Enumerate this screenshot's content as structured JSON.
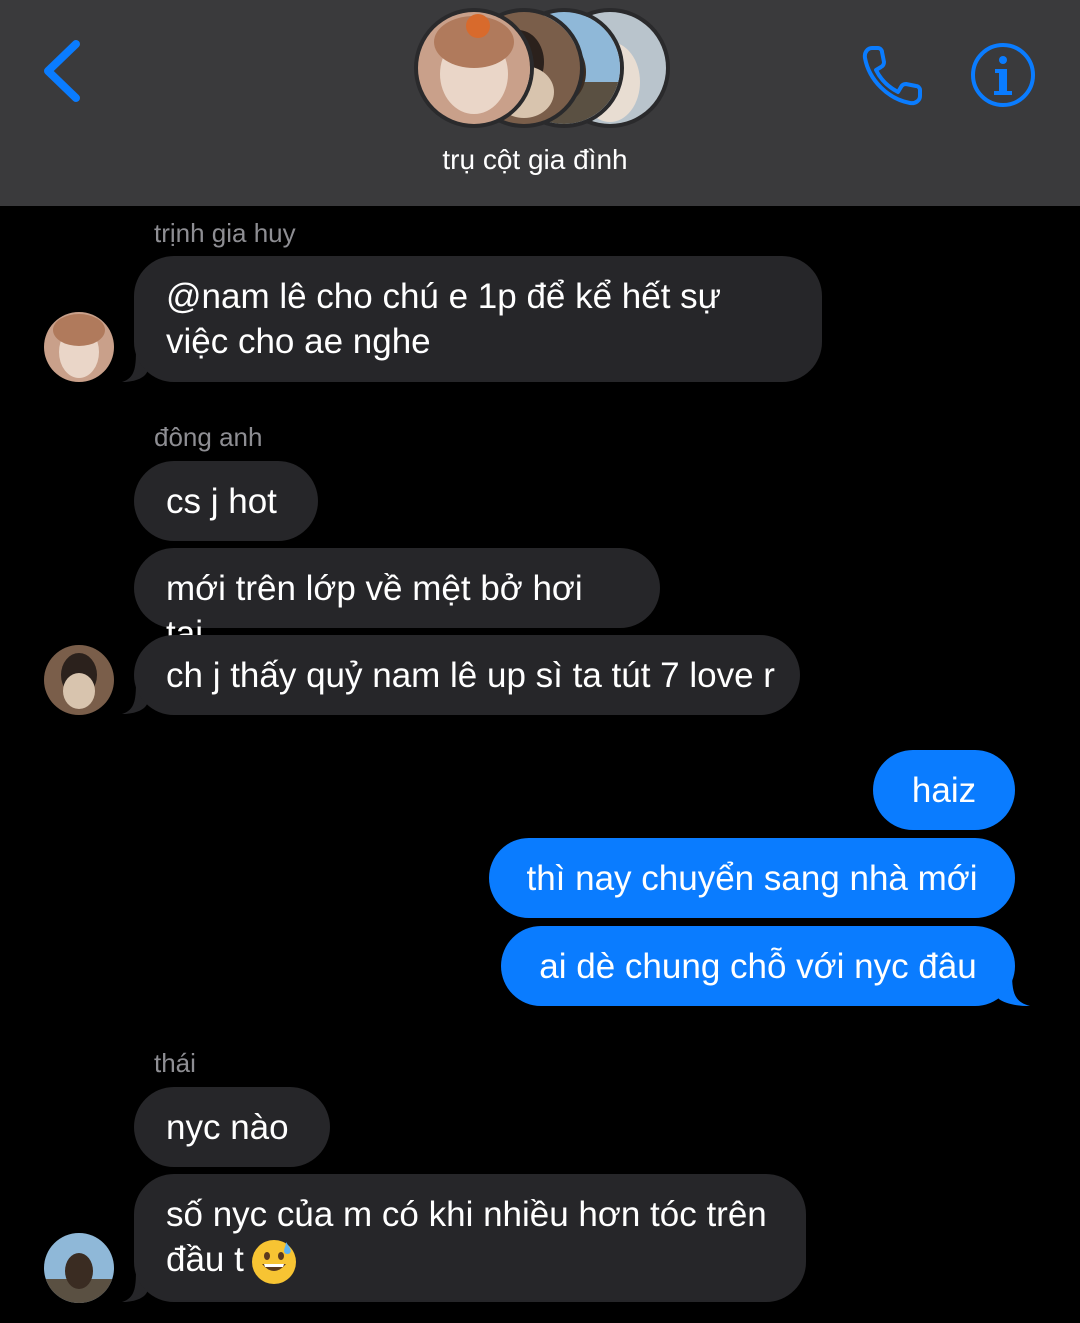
{
  "header": {
    "title": "trụ cột gia đình",
    "icons": {
      "back": "chevron-left-icon",
      "call": "phone-icon",
      "info": "info-icon"
    },
    "accent_color": "#0a7cff"
  },
  "messages": [
    {
      "sender": "trịnh gia huy",
      "text": "@nam lê cho chú e 1p để kể hết sự việc cho ae nghe",
      "direction": "incoming"
    },
    {
      "sender": "đông anh",
      "text": "cs j hot",
      "direction": "incoming"
    },
    {
      "text": "mới trên lớp về mệt bở hơi tai",
      "direction": "incoming"
    },
    {
      "text": "ch j thấy quỷ nam lê up sì ta tút 7 love r",
      "direction": "incoming"
    },
    {
      "text": "haiz",
      "direction": "outgoing"
    },
    {
      "text": "thì nay chuyển sang nhà mới",
      "direction": "outgoing"
    },
    {
      "text": "ai dè chung chỗ với nyc đâu",
      "direction": "outgoing"
    },
    {
      "sender": "thái",
      "text": "nyc nào",
      "direction": "incoming"
    },
    {
      "text": "số nyc của m có khi nhiều hơn tóc trên đầu t",
      "emoji": "grinning-sweat-emoji",
      "direction": "incoming"
    }
  ]
}
